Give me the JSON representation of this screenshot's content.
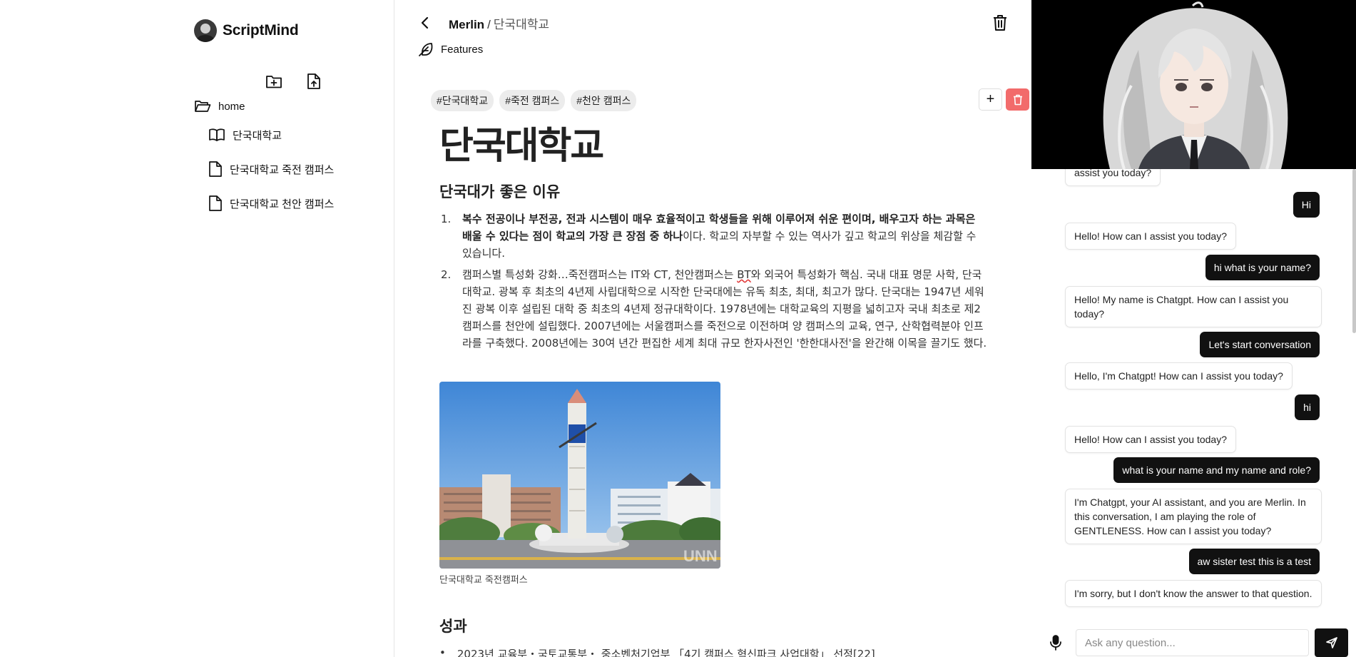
{
  "app": {
    "name": "ScriptMind"
  },
  "sidebar": {
    "new_folder_icon": "folder-plus-icon",
    "upload_icon": "file-upload-icon",
    "home": {
      "label": "home",
      "icon": "folder-open-icon"
    },
    "items": [
      {
        "label": "단국대학교",
        "icon": "book-open-icon"
      },
      {
        "label": "단국대학교 죽전 캠퍼스",
        "icon": "file-icon"
      },
      {
        "label": "단국대학교 천안 캠퍼스",
        "icon": "file-icon"
      }
    ]
  },
  "editor": {
    "breadcrumb": {
      "root": "Merlin",
      "separator": "/",
      "current": "단국대학교"
    },
    "features_label": "Features",
    "tags": [
      "#단국대학교",
      "#죽전 캠퍼스",
      "#천안 캠퍼스"
    ],
    "add_tag_label": "+",
    "doc": {
      "title": "단국대학교",
      "heading": "단국대가 좋은 이유",
      "list": [
        {
          "num": "1.",
          "bold": "복수 전공이나 부전공, 전과 시스템이 매우 효율적이고 학생들을 위해 이루어져 쉬운 편이며, 배우고자 하는 과목은 배울 수 있다는 점이 학교의 가장 큰 장점 중 하나",
          "text": "이다. 학교의 자부할 수 있는 역사가 깊고 학교의 위상을 체감할 수 있습니다."
        },
        {
          "num": "2.",
          "text_before": "캠퍼스별 특성화 강화…죽전캠퍼스는 IT와 CT, 천안캠퍼스는 ",
          "misspelled": "BT",
          "text_after": "와 외국어 특성화가 핵심. 국내 대표 명문 사학, 단국대학교. 광복 후 최초의 4년제 사립대학으로 시작한 단국대에는 유독 최초, 최대, 최고가 많다. 단국대는 1947년 세워진 광복 이후 설립된 대학 중 최초의 4년제 정규대학이다. 1978년에는 대학교육의 지평을 넓히고자 국내 최초로 제2캠퍼스를 천안에 설립했다. 2007년에는 서울캠퍼스를 죽전으로 이전하며 양 캠퍼스의 교육, 연구, 산학협력분야 인프라를 구축했다. 2008년에는 30여 년간 편집한 세계 최대 규모 한자사전인 '한한대사전'을 완간해 이목을 끌기도 했다."
        }
      ],
      "image_caption": "단국대학교 죽전캠퍼스",
      "image_watermark": "UNN",
      "section2_heading": "성과",
      "bullets": [
        {
          "marker": "•",
          "text": "2023년 교육부・국토교통부・ 중소벤처기업부 「4기 캠퍼스 혁신파크 사업대학」 선정[22]"
        }
      ]
    }
  },
  "chat": {
    "messages": [
      {
        "role": "bot",
        "text": "assist you today?"
      },
      {
        "role": "user",
        "text": "Hi"
      },
      {
        "role": "bot",
        "text": "Hello! How can I assist you today?"
      },
      {
        "role": "user",
        "text": "hi what is your name?"
      },
      {
        "role": "bot",
        "text": "Hello! My name is Chatgpt. How can I assist you today?"
      },
      {
        "role": "user",
        "text": "Let's start conversation"
      },
      {
        "role": "bot",
        "text": "Hello, I'm Chatgpt! How can I assist you today?"
      },
      {
        "role": "user",
        "text": "hi"
      },
      {
        "role": "bot",
        "text": "Hello! How can I assist you today?"
      },
      {
        "role": "user",
        "text": "what is your name and my name and role?"
      },
      {
        "role": "bot",
        "text": "I'm Chatgpt, your AI assistant, and you are Merlin. In this conversation, I am playing the role of GENTLENESS. How can I assist you today?"
      },
      {
        "role": "user",
        "text": "aw sister test this is a test"
      },
      {
        "role": "bot",
        "text": "I'm sorry, but I don't know the answer to that question."
      }
    ],
    "input_placeholder": "Ask any question...",
    "input_value": ""
  },
  "colors": {
    "danger": "#f26b6b",
    "primary": "#111111",
    "tag_bg": "#ececec"
  }
}
